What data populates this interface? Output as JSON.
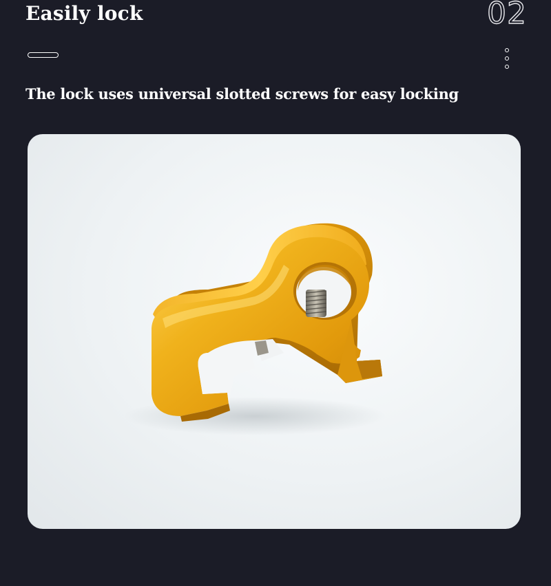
{
  "header": {
    "title": "Easily lock",
    "page_number": "02"
  },
  "subtitle": "The lock uses universal slotted screws for easy locking",
  "product_image": {
    "icon": "gold-aluminum-lock-clamp-photo",
    "color_primary": "#e7a20e",
    "color_highlight": "#ffd55a",
    "color_shadow": "#a86a04"
  },
  "decor": {
    "divider_icon": "pill-line-icon",
    "menu_icon": "vertical-dots-icon"
  }
}
